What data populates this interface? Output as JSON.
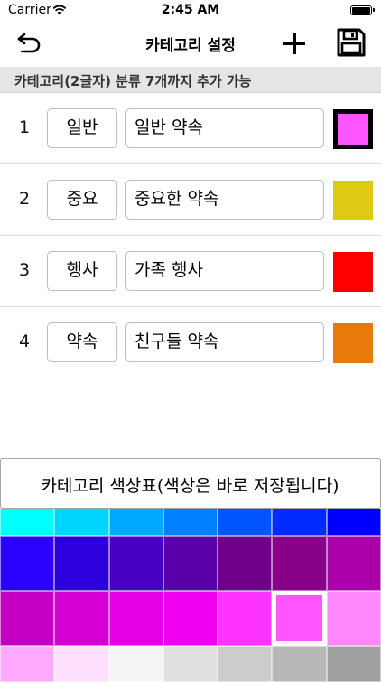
{
  "status_bar": {
    "carrier": "Carrier",
    "time": "2:45 AM"
  },
  "nav": {
    "title": "카테고리 설정",
    "icons": {
      "back": "back-arrow-icon",
      "add": "plus-icon",
      "save": "floppy-disk-icon"
    }
  },
  "info_text": "카테고리(2글자) 분류 7개까지 추가 가능",
  "categories": [
    {
      "num": "1",
      "short": "일반",
      "full": "일반 약속",
      "color": "#ff55ff",
      "selected": true
    },
    {
      "num": "2",
      "short": "중요",
      "full": "중요한 약속",
      "color": "#dccb12",
      "selected": false
    },
    {
      "num": "3",
      "short": "행사",
      "full": "가족 행사",
      "color": "#ff0000",
      "selected": false
    },
    {
      "num": "4",
      "short": "약속",
      "full": "친구들 약속",
      "color": "#e87a0b",
      "selected": false
    }
  ],
  "palette": {
    "title": "카테고리 색상표(색상은 바로 저장됩니다)",
    "rows": [
      [
        "#00ffff",
        "#00d5ff",
        "#00aaff",
        "#0080ff",
        "#0055ff",
        "#002bff",
        "#0000ff"
      ],
      [
        "#2b00ff",
        "#2b00dd",
        "#4a00c4",
        "#5a00aa",
        "#700088",
        "#880088",
        "#aa00aa"
      ],
      [
        "#c400c4",
        "#d400d4",
        "#e600e6",
        "#f000f0",
        "#ff33ff",
        "#ff55ff",
        "#ff88ff"
      ],
      [
        "#ffaaff",
        "#ffe0ff",
        "#f5f5f5",
        "#e0e0e0",
        "#cccccc",
        "#b8b8b8",
        "#a0a0a0"
      ]
    ],
    "selected": [
      2,
      5
    ]
  }
}
